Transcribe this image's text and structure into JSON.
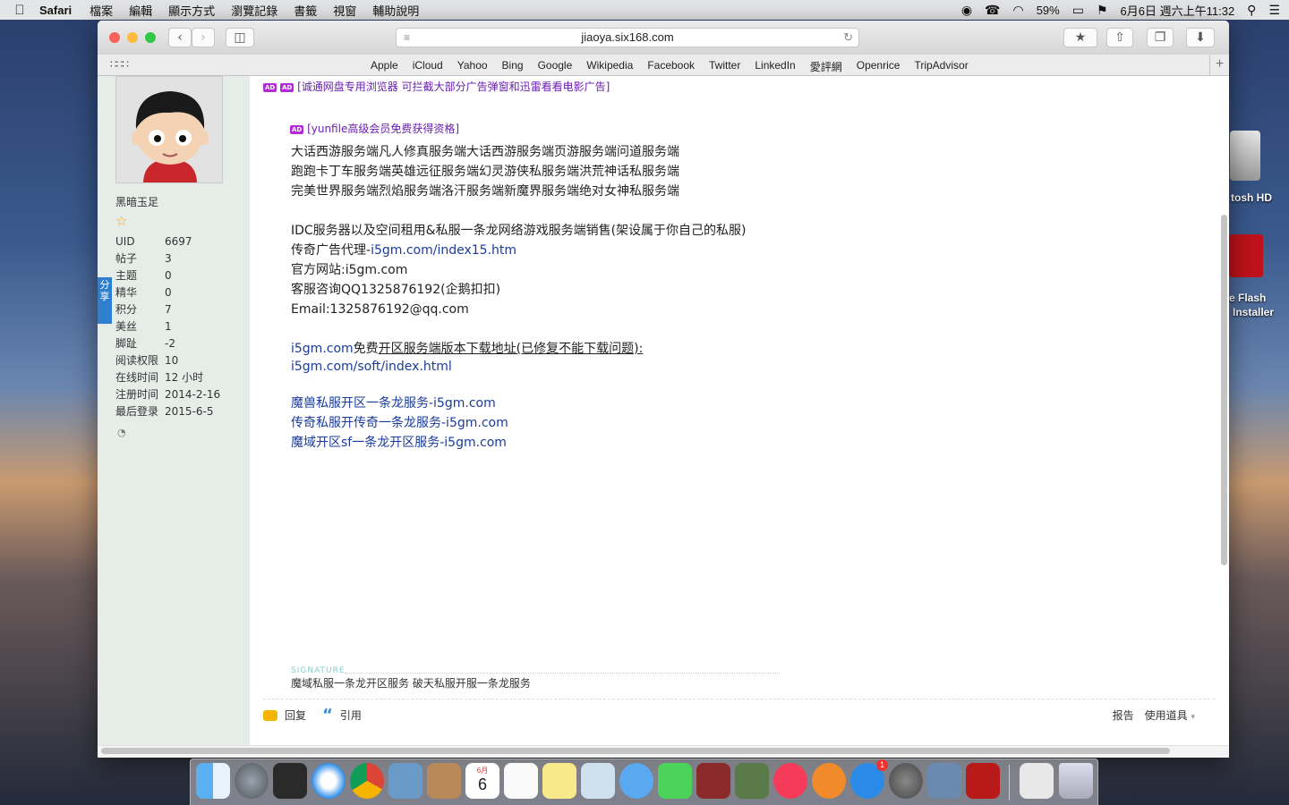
{
  "menubar": {
    "app_name": "Safari",
    "items": [
      "檔案",
      "編輯",
      "顯示方式",
      "瀏覽記錄",
      "書籤",
      "視窗",
      "輔助說明"
    ],
    "battery": "59%",
    "clock": "6月6日 週六上午11:32"
  },
  "desktop": {
    "hd_label": "tosh HD",
    "flash_label_1": "e Flash",
    "flash_label_2": "Installer"
  },
  "browser": {
    "url": "jiaoya.six168.com",
    "favorites": [
      "Apple",
      "iCloud",
      "Yahoo",
      "Bing",
      "Google",
      "Wikipedia",
      "Facebook",
      "Twitter",
      "LinkedIn",
      "愛評網",
      "Openrice",
      "TripAdvisor"
    ]
  },
  "profile": {
    "username": "黑暗玉足",
    "stats": [
      {
        "k": "UID",
        "v": "6697"
      },
      {
        "k": "帖子",
        "v": "3"
      },
      {
        "k": "主题",
        "v": "0"
      },
      {
        "k": "精华",
        "v": "0"
      },
      {
        "k": "积分",
        "v": "7"
      },
      {
        "k": "美丝",
        "v": "1"
      },
      {
        "k": "脚趾",
        "v": "-2"
      },
      {
        "k": "阅读权限",
        "v": "10"
      },
      {
        "k": "在线时间",
        "v": "12 小时"
      },
      {
        "k": "注册时间",
        "v": "2014-2-16"
      },
      {
        "k": "最后登录",
        "v": "2015-6-5"
      }
    ],
    "share_label": "分享"
  },
  "post": {
    "ad_tag": "AD",
    "ad1": "[诚通网盘专用浏览器 可拦截大部分广告弹窗和迅雷看看电影广告]",
    "ad2": "[yunfile高级会员免费获得资格]",
    "line1": "大话西游服务端凡人修真服务端大话西游服务端页游服务端问道服务端",
    "line2": "跑跑卡丁车服务端英雄远征服务端幻灵游侠私服务端洪荒神话私服务端",
    "line3": "完美世界服务端烈焰服务端洛汗服务端新魔界服务端绝对女神私服务端",
    "line4": "IDC服务器以及空间租用&私服一条龙网络游戏服务端销售(架设属于你自己的私服)",
    "line5_prefix": "传奇广告代理-",
    "line5_link": "i5gm.com/index15.htm",
    "line6": "官方网站:i5gm.com",
    "line7": "客服咨询QQ1325876192(企鹅扣扣)",
    "line8": "Email:1325876192@qq.com",
    "line9_link": "i5gm.com",
    "line9_mid": "免费",
    "line9_under": "开区服务端版本下载地址(已修复不能下载问题):",
    "line10": "i5gm.com/soft/index.html",
    "link1": "魔兽私服开区一条龙服务-i5gm.com",
    "link2": "传奇私服开传奇一条龙服务-i5gm.com",
    "link3": "魔域开区sf一条龙开区服务-i5gm.com",
    "signature_label": "SIGNATURE",
    "signature": "魔域私服一条龙开区服务 破天私服开服一条龙服务",
    "reply": "回复",
    "quote": "引用",
    "report": "报告",
    "tools": "使用道具"
  },
  "dock": {
    "calendar_month": "6月",
    "calendar_day": "6",
    "appstore_badge": "1"
  },
  "colors": {
    "link": "#1a3b9a",
    "ad": "#6a1fb0",
    "sidebar_bg": "#e6ede8"
  }
}
